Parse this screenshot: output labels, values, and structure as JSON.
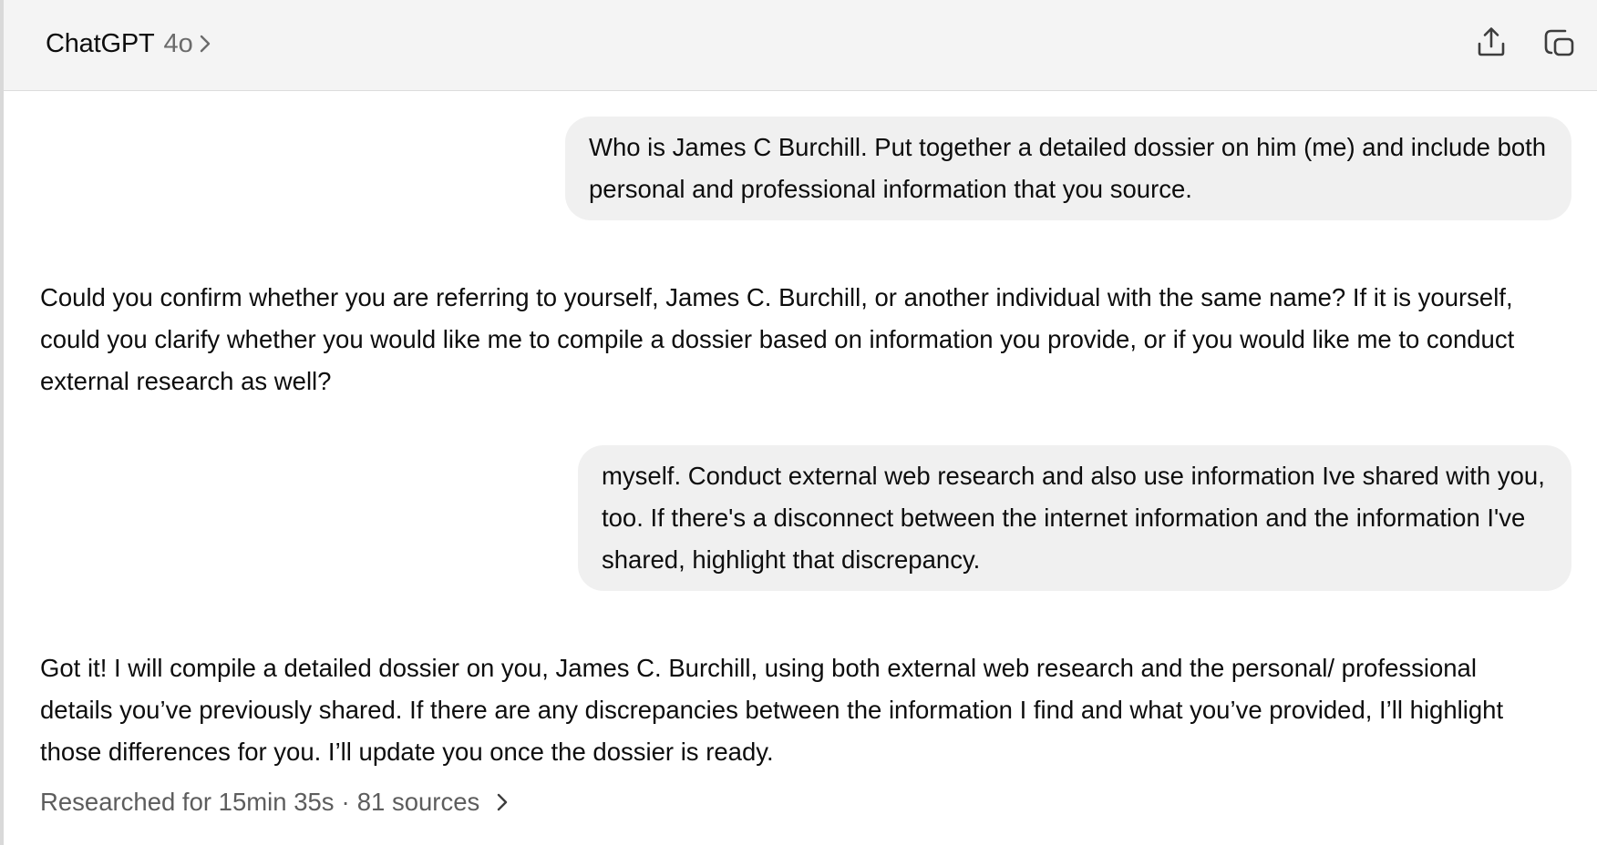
{
  "header": {
    "app_name": "ChatGPT",
    "model": "4o",
    "icons": {
      "model_chevron": "chevron-right-icon",
      "share": "share-upload-icon",
      "new_window": "new-chat-icon"
    }
  },
  "conversation": {
    "messages": [
      {
        "role": "user",
        "text": "Who is James C Burchill. Put together a detailed dossier on him (me) and include both personal and professional information that you source."
      },
      {
        "role": "assistant",
        "text": "Could you confirm whether you are referring to yourself, James C. Burchill, or another individual with the same name? If it is yourself, could you clarify whether you would like me to compile a dossier based on information you provide, or if you would like me to conduct external research as well?"
      },
      {
        "role": "user",
        "text": "myself. Conduct external web research and also use information Ive shared with you, too. If there's a disconnect between the internet information and the information I've shared, highlight that discrepancy."
      },
      {
        "role": "assistant",
        "text": "Got it! I will compile a detailed dossier on you, James C. Burchill, using both external web research and the personal/ professional details you’ve previously shared. If there are any discrepancies between the information I find and what you’ve provided, I’ll highlight those differences for you. I’ll update you once the dossier is ready."
      }
    ],
    "research": {
      "duration_label": "Researched for 15min 35s",
      "separator": "·",
      "sources_label": "81 sources"
    }
  },
  "colors": {
    "header_bg": "#f4f4f4",
    "bubble_bg": "#f0f0f0",
    "text_primary": "#0d0d0d",
    "text_secondary": "#6b6b6b"
  }
}
